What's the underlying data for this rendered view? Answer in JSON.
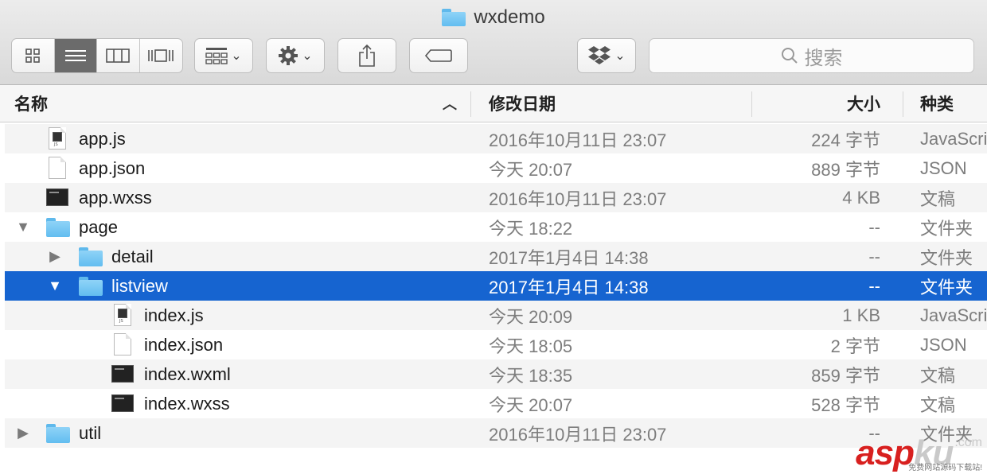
{
  "window": {
    "title": "wxdemo"
  },
  "toolbar": {
    "view_buttons": [
      "icon-view-icon",
      "list-view-icon",
      "column-view-icon",
      "coverflow-view-icon"
    ],
    "search_placeholder": "搜索"
  },
  "columns": {
    "name": "名称",
    "date": "修改日期",
    "size": "大小",
    "kind": "种类"
  },
  "rows": [
    {
      "name": "app.js",
      "date": "2016年10月11日 23:07",
      "size": "224 字节",
      "kind": "JavaScript",
      "icon": "js-file-icon",
      "level": 0,
      "disclosure": ""
    },
    {
      "name": "app.json",
      "date": "今天 20:07",
      "size": "889 字节",
      "kind": "JSON",
      "icon": "document-icon",
      "level": 0,
      "disclosure": ""
    },
    {
      "name": "app.wxss",
      "date": "2016年10月11日 23:07",
      "size": "4 KB",
      "kind": "文稿",
      "icon": "terminal-file-icon",
      "level": 0,
      "disclosure": ""
    },
    {
      "name": "page",
      "date": "今天 18:22",
      "size": "--",
      "kind": "文件夹",
      "icon": "folder-icon",
      "level": 0,
      "disclosure": "▼"
    },
    {
      "name": "detail",
      "date": "2017年1月4日 14:38",
      "size": "--",
      "kind": "文件夹",
      "icon": "folder-icon",
      "level": 1,
      "disclosure": "▶"
    },
    {
      "name": "listview",
      "date": "2017年1月4日 14:38",
      "size": "--",
      "kind": "文件夹",
      "icon": "folder-icon",
      "level": 1,
      "disclosure": "▼",
      "selected": true
    },
    {
      "name": "index.js",
      "date": "今天 20:09",
      "size": "1 KB",
      "kind": "JavaScript",
      "icon": "js-file-icon",
      "level": 2,
      "disclosure": ""
    },
    {
      "name": "index.json",
      "date": "今天 18:05",
      "size": "2 字节",
      "kind": "JSON",
      "icon": "document-icon",
      "level": 2,
      "disclosure": ""
    },
    {
      "name": "index.wxml",
      "date": "今天 18:35",
      "size": "859 字节",
      "kind": "文稿",
      "icon": "terminal-file-icon",
      "level": 2,
      "disclosure": ""
    },
    {
      "name": "index.wxss",
      "date": "今天 20:07",
      "size": "528 字节",
      "kind": "文稿",
      "icon": "terminal-file-icon",
      "level": 2,
      "disclosure": ""
    },
    {
      "name": "util",
      "date": "2016年10月11日 23:07",
      "size": "--",
      "kind": "文件夹",
      "icon": "folder-icon",
      "level": 0,
      "disclosure": "▶"
    }
  ],
  "watermark": {
    "text": "asp",
    "ku": "ku",
    "domain": ".com",
    "sub": "免费网站源码下载站!"
  }
}
